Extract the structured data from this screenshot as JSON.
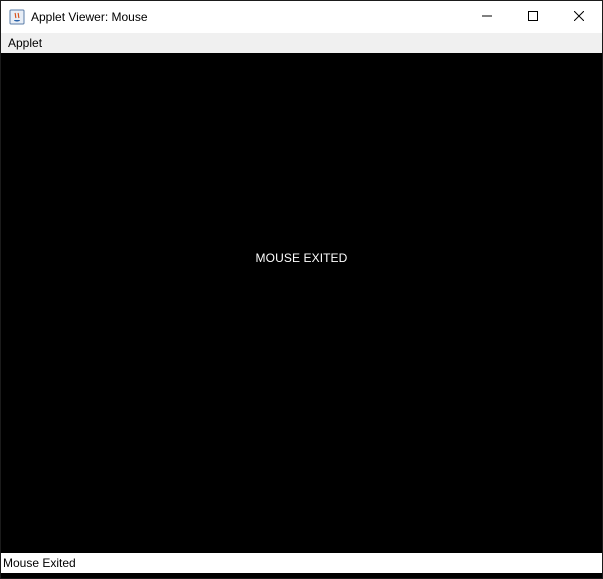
{
  "window": {
    "title": "Applet Viewer: Mouse",
    "icon": "java-applet-icon",
    "controls": {
      "minimize_icon": "minimize-icon",
      "maximize_icon": "maximize-icon",
      "close_icon": "close-icon"
    }
  },
  "menubar": {
    "items": [
      {
        "label": "Applet"
      }
    ]
  },
  "canvas": {
    "message": "MOUSE EXITED",
    "background": "#000000",
    "text_color": "#ffffff"
  },
  "statusbar": {
    "text": "Mouse Exited"
  }
}
